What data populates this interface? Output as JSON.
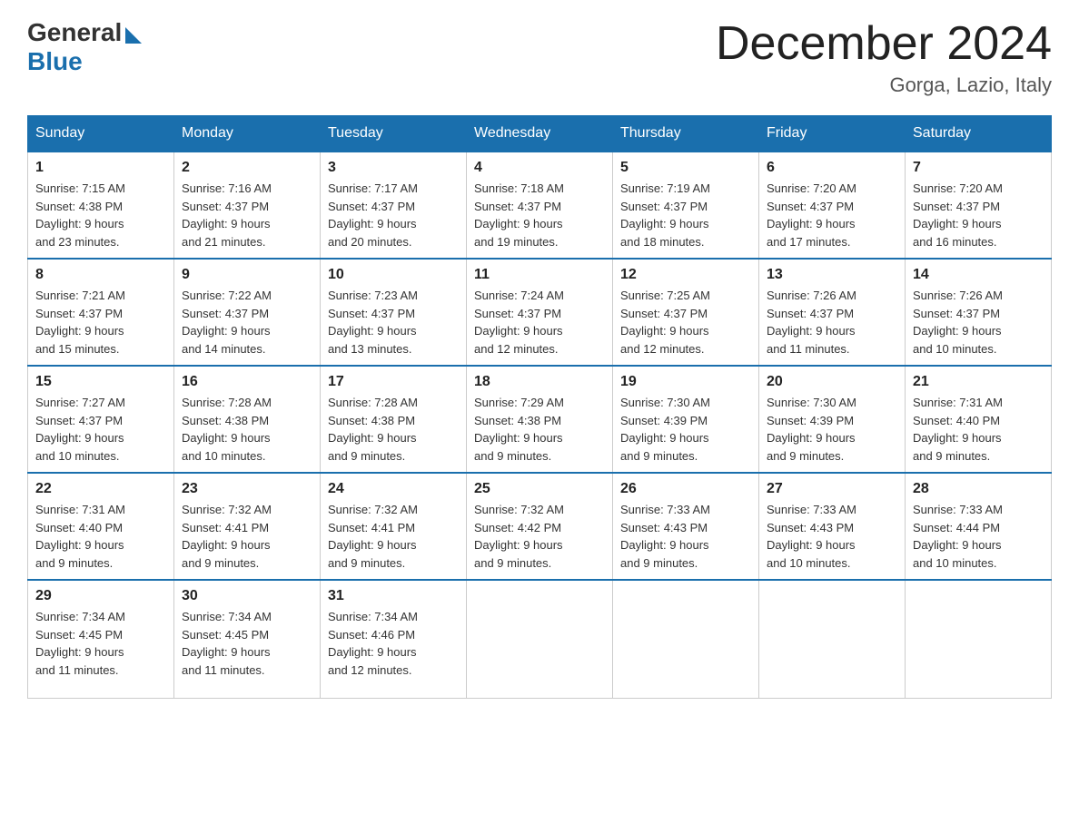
{
  "logo": {
    "general": "General",
    "blue": "Blue"
  },
  "title": "December 2024",
  "location": "Gorga, Lazio, Italy",
  "days_of_week": [
    "Sunday",
    "Monday",
    "Tuesday",
    "Wednesday",
    "Thursday",
    "Friday",
    "Saturday"
  ],
  "weeks": [
    [
      {
        "day": "1",
        "sunrise": "7:15 AM",
        "sunset": "4:38 PM",
        "daylight": "9 hours and 23 minutes."
      },
      {
        "day": "2",
        "sunrise": "7:16 AM",
        "sunset": "4:37 PM",
        "daylight": "9 hours and 21 minutes."
      },
      {
        "day": "3",
        "sunrise": "7:17 AM",
        "sunset": "4:37 PM",
        "daylight": "9 hours and 20 minutes."
      },
      {
        "day": "4",
        "sunrise": "7:18 AM",
        "sunset": "4:37 PM",
        "daylight": "9 hours and 19 minutes."
      },
      {
        "day": "5",
        "sunrise": "7:19 AM",
        "sunset": "4:37 PM",
        "daylight": "9 hours and 18 minutes."
      },
      {
        "day": "6",
        "sunrise": "7:20 AM",
        "sunset": "4:37 PM",
        "daylight": "9 hours and 17 minutes."
      },
      {
        "day": "7",
        "sunrise": "7:20 AM",
        "sunset": "4:37 PM",
        "daylight": "9 hours and 16 minutes."
      }
    ],
    [
      {
        "day": "8",
        "sunrise": "7:21 AM",
        "sunset": "4:37 PM",
        "daylight": "9 hours and 15 minutes."
      },
      {
        "day": "9",
        "sunrise": "7:22 AM",
        "sunset": "4:37 PM",
        "daylight": "9 hours and 14 minutes."
      },
      {
        "day": "10",
        "sunrise": "7:23 AM",
        "sunset": "4:37 PM",
        "daylight": "9 hours and 13 minutes."
      },
      {
        "day": "11",
        "sunrise": "7:24 AM",
        "sunset": "4:37 PM",
        "daylight": "9 hours and 12 minutes."
      },
      {
        "day": "12",
        "sunrise": "7:25 AM",
        "sunset": "4:37 PM",
        "daylight": "9 hours and 12 minutes."
      },
      {
        "day": "13",
        "sunrise": "7:26 AM",
        "sunset": "4:37 PM",
        "daylight": "9 hours and 11 minutes."
      },
      {
        "day": "14",
        "sunrise": "7:26 AM",
        "sunset": "4:37 PM",
        "daylight": "9 hours and 10 minutes."
      }
    ],
    [
      {
        "day": "15",
        "sunrise": "7:27 AM",
        "sunset": "4:37 PM",
        "daylight": "9 hours and 10 minutes."
      },
      {
        "day": "16",
        "sunrise": "7:28 AM",
        "sunset": "4:38 PM",
        "daylight": "9 hours and 10 minutes."
      },
      {
        "day": "17",
        "sunrise": "7:28 AM",
        "sunset": "4:38 PM",
        "daylight": "9 hours and 9 minutes."
      },
      {
        "day": "18",
        "sunrise": "7:29 AM",
        "sunset": "4:38 PM",
        "daylight": "9 hours and 9 minutes."
      },
      {
        "day": "19",
        "sunrise": "7:30 AM",
        "sunset": "4:39 PM",
        "daylight": "9 hours and 9 minutes."
      },
      {
        "day": "20",
        "sunrise": "7:30 AM",
        "sunset": "4:39 PM",
        "daylight": "9 hours and 9 minutes."
      },
      {
        "day": "21",
        "sunrise": "7:31 AM",
        "sunset": "4:40 PM",
        "daylight": "9 hours and 9 minutes."
      }
    ],
    [
      {
        "day": "22",
        "sunrise": "7:31 AM",
        "sunset": "4:40 PM",
        "daylight": "9 hours and 9 minutes."
      },
      {
        "day": "23",
        "sunrise": "7:32 AM",
        "sunset": "4:41 PM",
        "daylight": "9 hours and 9 minutes."
      },
      {
        "day": "24",
        "sunrise": "7:32 AM",
        "sunset": "4:41 PM",
        "daylight": "9 hours and 9 minutes."
      },
      {
        "day": "25",
        "sunrise": "7:32 AM",
        "sunset": "4:42 PM",
        "daylight": "9 hours and 9 minutes."
      },
      {
        "day": "26",
        "sunrise": "7:33 AM",
        "sunset": "4:43 PM",
        "daylight": "9 hours and 9 minutes."
      },
      {
        "day": "27",
        "sunrise": "7:33 AM",
        "sunset": "4:43 PM",
        "daylight": "9 hours and 10 minutes."
      },
      {
        "day": "28",
        "sunrise": "7:33 AM",
        "sunset": "4:44 PM",
        "daylight": "9 hours and 10 minutes."
      }
    ],
    [
      {
        "day": "29",
        "sunrise": "7:34 AM",
        "sunset": "4:45 PM",
        "daylight": "9 hours and 11 minutes."
      },
      {
        "day": "30",
        "sunrise": "7:34 AM",
        "sunset": "4:45 PM",
        "daylight": "9 hours and 11 minutes."
      },
      {
        "day": "31",
        "sunrise": "7:34 AM",
        "sunset": "4:46 PM",
        "daylight": "9 hours and 12 minutes."
      },
      null,
      null,
      null,
      null
    ]
  ]
}
